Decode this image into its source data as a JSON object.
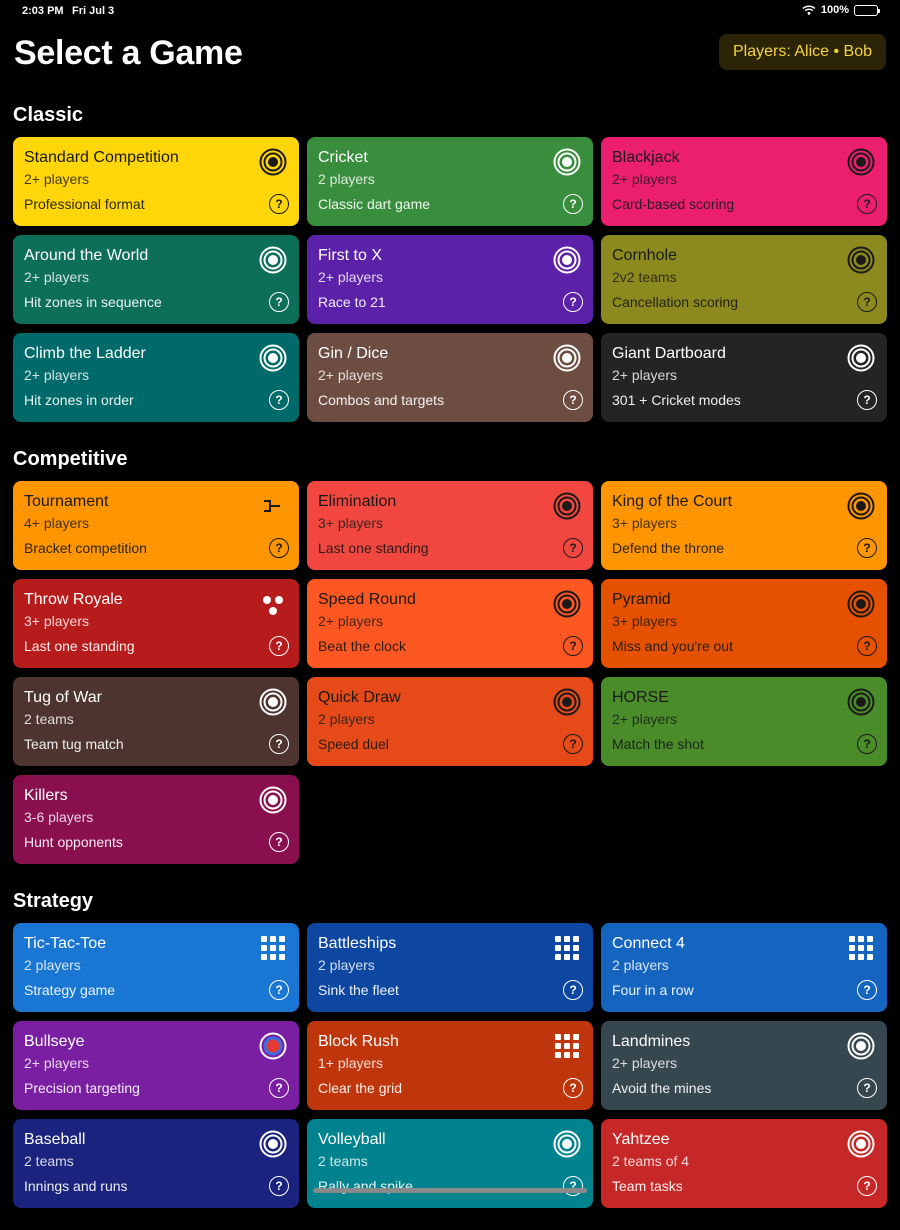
{
  "status_bar": {
    "time": "2:03 PM",
    "date": "Fri Jul 3",
    "battery": "100%"
  },
  "header": {
    "title": "Select a Game",
    "players_label": "Players: Alice • Bob"
  },
  "help_glyph": "?",
  "sections": [
    {
      "title": "Classic",
      "games": [
        {
          "name": "Standard Competition",
          "players": "2+ players",
          "desc": "Professional format",
          "color": "#ffd60a",
          "dark_text": true,
          "icon": "target-icon"
        },
        {
          "name": "Cricket",
          "players": "2 players",
          "desc": "Classic dart game",
          "color": "#388e3c",
          "dark_text": false,
          "icon": "target-icon"
        },
        {
          "name": "Blackjack",
          "players": "2+ players",
          "desc": "Card-based scoring",
          "color": "#ec1f6e",
          "dark_text": true,
          "icon": "target-icon"
        },
        {
          "name": "Around the World",
          "players": "2+ players",
          "desc": "Hit zones in sequence",
          "color": "#0d6e5a",
          "dark_text": false,
          "icon": "target-icon"
        },
        {
          "name": "First to X",
          "players": "2+ players",
          "desc": "Race to 21",
          "color": "#5b21a8",
          "dark_text": false,
          "icon": "target-icon"
        },
        {
          "name": "Cornhole",
          "players": "2v2 teams",
          "desc": "Cancellation scoring",
          "color": "#8c8a1e",
          "dark_text": true,
          "icon": "target-icon"
        },
        {
          "name": "Climb the Ladder",
          "players": "2+ players",
          "desc": "Hit zones in order",
          "color": "#006a6a",
          "dark_text": false,
          "icon": "target-icon"
        },
        {
          "name": "Gin / Dice",
          "players": "2+ players",
          "desc": "Combos and targets",
          "color": "#6d4c41",
          "dark_text": false,
          "icon": "target-icon"
        },
        {
          "name": "Giant Dartboard",
          "players": "2+ players",
          "desc": "301 + Cricket modes",
          "color": "#242424",
          "dark_text": false,
          "icon": "target-icon"
        }
      ]
    },
    {
      "title": "Competitive",
      "games": [
        {
          "name": "Tournament",
          "players": "4+ players",
          "desc": "Bracket competition",
          "color": "#ff9500",
          "dark_text": true,
          "icon": "bracket-icon"
        },
        {
          "name": "Elimination",
          "players": "3+ players",
          "desc": "Last one standing",
          "color": "#f2473f",
          "dark_text": true,
          "icon": "target-icon"
        },
        {
          "name": "King of the Court",
          "players": "3+ players",
          "desc": "Defend the throne",
          "color": "#ff9500",
          "dark_text": true,
          "icon": "target-icon"
        },
        {
          "name": "Throw Royale",
          "players": "3+ players",
          "desc": "Last one standing",
          "color": "#b71c1c",
          "dark_text": false,
          "icon": "dots-icon"
        },
        {
          "name": "Speed Round",
          "players": "2+ players",
          "desc": "Beat the clock",
          "color": "#ff5722",
          "dark_text": true,
          "icon": "target-icon"
        },
        {
          "name": "Pyramid",
          "players": "3+ players",
          "desc": "Miss and you're out",
          "color": "#e65100",
          "dark_text": true,
          "icon": "target-icon"
        },
        {
          "name": "Tug of War",
          "players": "2 teams",
          "desc": "Team tug match",
          "color": "#4e342e",
          "dark_text": false,
          "icon": "target-icon"
        },
        {
          "name": "Quick Draw",
          "players": "2 players",
          "desc": "Speed duel",
          "color": "#e64a19",
          "dark_text": true,
          "icon": "target-icon"
        },
        {
          "name": "HORSE",
          "players": "2+ players",
          "desc": "Match the shot",
          "color": "#4a8c2a",
          "dark_text": true,
          "icon": "target-icon"
        },
        {
          "name": "Killers",
          "players": "3-6 players",
          "desc": "Hunt opponents",
          "color": "#8a0f4f",
          "dark_text": false,
          "icon": "target-icon"
        }
      ]
    },
    {
      "title": "Strategy",
      "games": [
        {
          "name": "Tic-Tac-Toe",
          "players": "2 players",
          "desc": "Strategy game",
          "color": "#1976d2",
          "dark_text": false,
          "icon": "grid-icon"
        },
        {
          "name": "Battleships",
          "players": "2 players",
          "desc": "Sink the fleet",
          "color": "#0d47a1",
          "dark_text": false,
          "icon": "grid-icon"
        },
        {
          "name": "Connect 4",
          "players": "2 players",
          "desc": "Four in a row",
          "color": "#1565c0",
          "dark_text": false,
          "icon": "grid-icon"
        },
        {
          "name": "Bullseye",
          "players": "2+ players",
          "desc": "Precision targeting",
          "color": "#7b1fa2",
          "dark_text": false,
          "icon": "bullseye-icon"
        },
        {
          "name": "Block Rush",
          "players": "1+ players",
          "desc": "Clear the grid",
          "color": "#bf360c",
          "dark_text": false,
          "icon": "grid-icon"
        },
        {
          "name": "Landmines",
          "players": "2+ players",
          "desc": "Avoid the mines",
          "color": "#37474f",
          "dark_text": false,
          "icon": "target-icon"
        },
        {
          "name": "Baseball",
          "players": "2 teams",
          "desc": "Innings and runs",
          "color": "#1a237e",
          "dark_text": false,
          "icon": "target-icon"
        },
        {
          "name": "Volleyball",
          "players": "2 teams",
          "desc": "Rally and spike",
          "color": "#00838f",
          "dark_text": false,
          "icon": "target-icon"
        },
        {
          "name": "Yahtzee",
          "players": "2 teams of 4",
          "desc": "Team tasks",
          "color": "#c62828",
          "dark_text": false,
          "icon": "target-icon"
        }
      ]
    }
  ]
}
